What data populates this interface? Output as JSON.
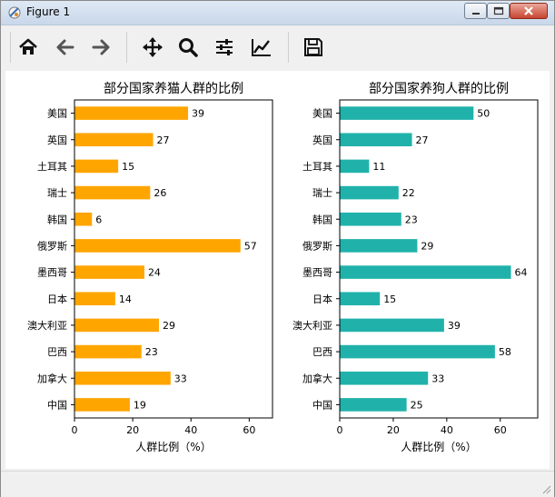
{
  "window": {
    "title": "Figure 1"
  },
  "toolbar": {
    "buttons": [
      {
        "name": "home",
        "icon": "home-icon"
      },
      {
        "name": "back",
        "icon": "arrow-left-icon"
      },
      {
        "name": "forward",
        "icon": "arrow-right-icon"
      },
      {
        "name": "pan",
        "icon": "move-arrows-icon"
      },
      {
        "name": "zoom",
        "icon": "magnifier-icon"
      },
      {
        "name": "configure-subplots",
        "icon": "sliders-icon"
      },
      {
        "name": "edit-axis",
        "icon": "line-chart-icon"
      },
      {
        "name": "save",
        "icon": "floppy-disk-icon"
      }
    ]
  },
  "chart_data": [
    {
      "type": "bar",
      "orientation": "horizontal",
      "title": "部分国家养猫人群的比例",
      "xlabel": "人群比例（%）",
      "ylabel": "",
      "categories": [
        "美国",
        "英国",
        "土耳其",
        "瑞士",
        "韩国",
        "俄罗斯",
        "墨西哥",
        "日本",
        "澳大利亚",
        "巴西",
        "加拿大",
        "中国"
      ],
      "values": [
        39,
        27,
        15,
        26,
        6,
        57,
        24,
        14,
        29,
        23,
        33,
        19
      ],
      "xlim": [
        0,
        68
      ],
      "xticks": [
        0,
        20,
        40,
        60
      ],
      "color": "#ffa500",
      "grid": false
    },
    {
      "type": "bar",
      "orientation": "horizontal",
      "title": "部分国家养狗人群的比例",
      "xlabel": "人群比例（%）",
      "ylabel": "",
      "categories": [
        "美国",
        "英国",
        "土耳其",
        "瑞士",
        "韩国",
        "俄罗斯",
        "墨西哥",
        "日本",
        "澳大利亚",
        "巴西",
        "加拿大",
        "中国"
      ],
      "values": [
        50,
        27,
        11,
        22,
        23,
        29,
        64,
        15,
        39,
        58,
        33,
        25
      ],
      "xlim": [
        0,
        74
      ],
      "xticks": [
        0,
        20,
        40,
        60
      ],
      "color": "#20b2aa",
      "grid": false
    }
  ]
}
